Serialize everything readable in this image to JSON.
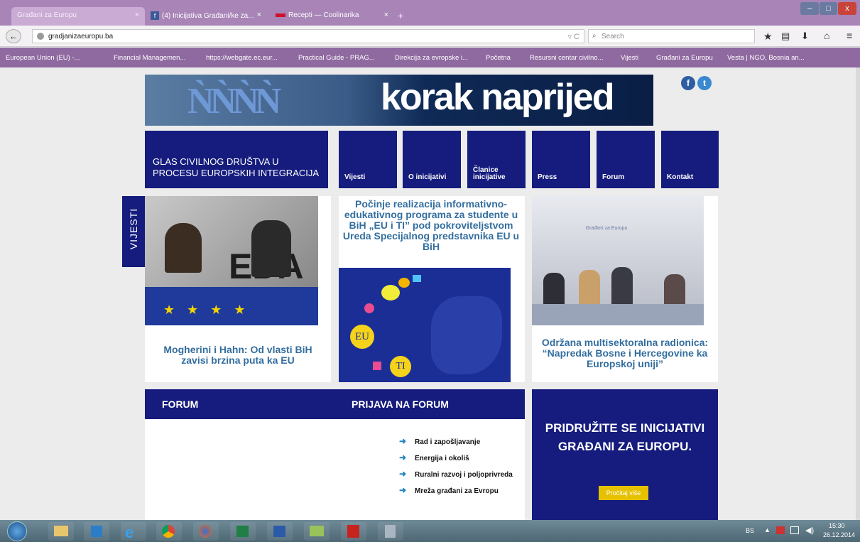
{
  "browser": {
    "tabs": [
      {
        "label": "Građani za Europu",
        "close": "×",
        "active": true
      },
      {
        "label": "(4) Inicijativa Građani/ke za...",
        "close": "×",
        "active": false
      },
      {
        "label": "Recepti — Coolinarika",
        "close": "×",
        "active": false
      }
    ],
    "new_tab": "+",
    "url": "gradjanizaeuropu.ba",
    "search_placeholder": "Search",
    "bookmarks": [
      "European Union (EU) -...",
      "Financial Managemen...",
      "https://webgate.ec.eur...",
      "Practical Guide - PRAG...",
      "Direkcija za evropske i...",
      "Početna",
      "Resursni centar civilno...",
      "Vijesti",
      "Građani za Europu",
      "Vesta | NGO, Bosnia an..."
    ]
  },
  "site": {
    "banner_title": "korak naprijed",
    "tagline": "GLAS CIVILNOG DRUŠTVA U PROCESU  EUROPSKIH INTEGRACIJA",
    "nav": [
      "Vijesti",
      "O inicijativi",
      "Članice inicijative",
      "Press",
      "Forum",
      "Kontakt"
    ],
    "vijesti_label": "VIJESTI",
    "news": [
      {
        "title": "Mogherini i Hahn: Od vlasti BiH zavisi brzina puta ka EU",
        "image_text": "EDA"
      },
      {
        "title": "Počinje realizacija informativno-edukativnog programa za studente u BiH „EU i TI” pod pokroviteljstvom Ureda Specijalnog predstavnika EU u BiH",
        "badge1": "EU",
        "badge2": "TI"
      },
      {
        "title": "Održana multisektoralna radionica: “Napredak Bosne i Hercegovine ka Europskoj uniji”",
        "image_text": "Građani za Europu"
      }
    ],
    "forum": {
      "heading": "FORUM",
      "login_heading": "PRIJAVA NA FORUM",
      "links": [
        "Rad i zapošljavanje",
        "Energija i okoliš",
        "Ruralni razvoj i poljoprivreda",
        "Mreža građani za Evropu"
      ]
    },
    "join": {
      "title": "PRIDRUŽITE SE INICIJATIVI GRAĐANI ZA EUROPU.",
      "button": "Pročitaj više"
    }
  },
  "taskbar": {
    "lang": "BS",
    "time": "15:30",
    "date": "26.12.2014"
  },
  "colors": {
    "navy": "#151c7d",
    "link_blue": "#336e9f",
    "tab_purple": "#a884b7",
    "button_yellow": "#e5c100"
  }
}
